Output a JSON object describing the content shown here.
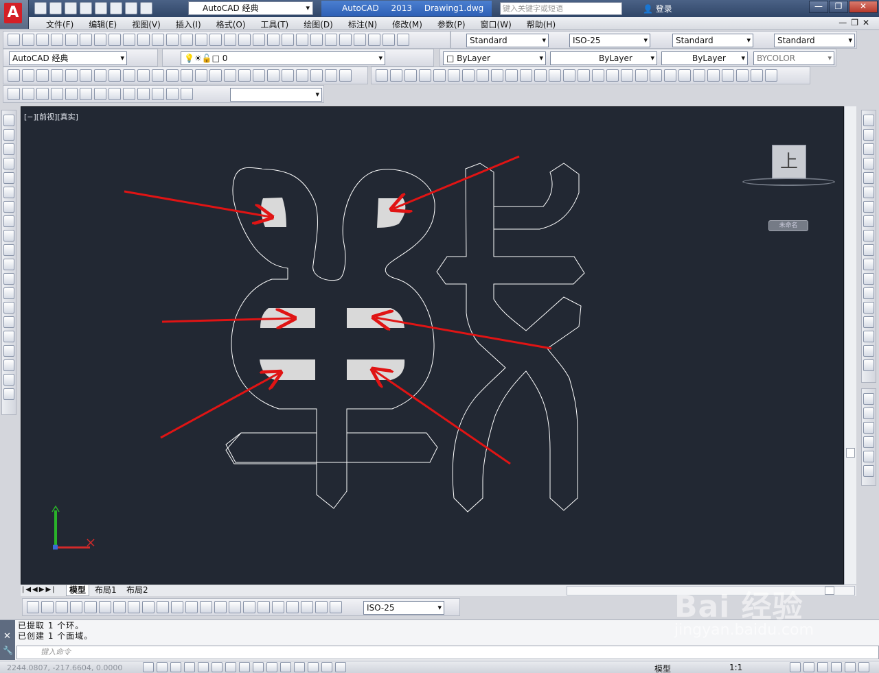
{
  "title_bar": {
    "workspace": "AutoCAD 经典",
    "app_name": "AutoCAD 2013",
    "doc_name": "Drawing1.dwg",
    "search_placeholder": "键入关键字或短语",
    "login": "登录"
  },
  "menu": [
    "文件(F)",
    "编辑(E)",
    "视图(V)",
    "插入(I)",
    "格式(O)",
    "工具(T)",
    "绘图(D)",
    "标注(N)",
    "修改(M)",
    "参数(P)",
    "窗口(W)",
    "帮助(H)"
  ],
  "styles": {
    "text_style": "Standard",
    "dim_style": "ISO-25",
    "table_style": "Standard",
    "multileader_style": "Standard"
  },
  "layers": {
    "workspace": "AutoCAD 经典",
    "current_layer": "0",
    "color": "ByLayer",
    "linetype": "ByLayer",
    "lineweight": "ByLayer",
    "plot_style": "BYCOLOR"
  },
  "viewport": {
    "label": "[−][前视][真实]",
    "viewcube_face": "上",
    "wcs": "未命名"
  },
  "tabs": [
    "模型",
    "布局1",
    "布局2"
  ],
  "dim_toolbar": {
    "dim_style": "ISO-25"
  },
  "command": {
    "history": [
      "已提取  1  个环。",
      "已创建  1  个面域。"
    ],
    "placeholder": "键入命令"
  },
  "status": {
    "coords": "2244.0807,  -217.6604,  0.0000",
    "model": "模型",
    "scale": "1:1"
  },
  "watermark": {
    "brand": "Bai  经验",
    "site": "jingyan.baidu.com"
  },
  "colors": {
    "viewport_bg": "#222833",
    "outline": "#ffffff",
    "fill": "#d9d9d9",
    "arrow": "#e01414"
  }
}
